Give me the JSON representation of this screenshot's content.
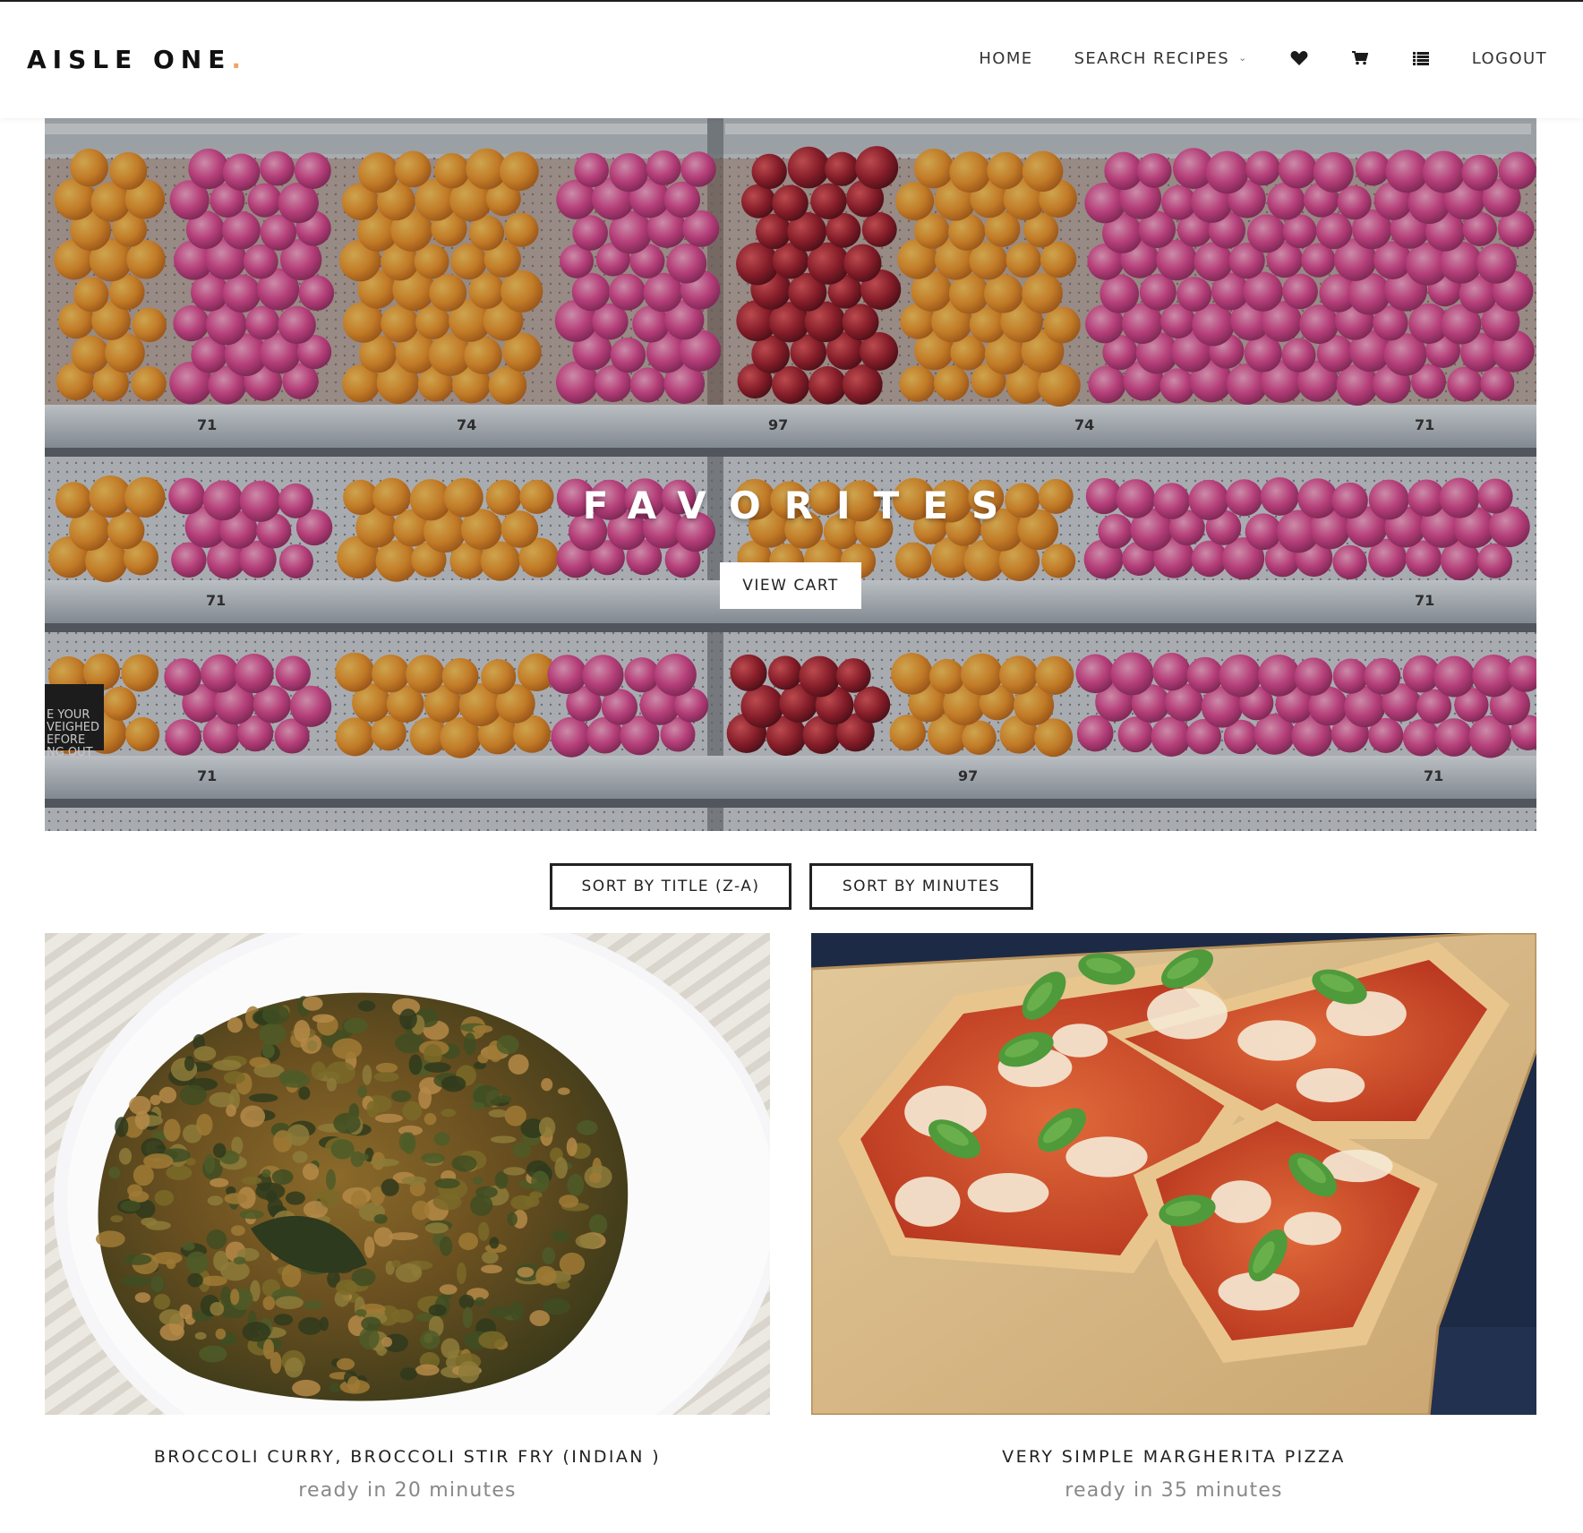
{
  "header": {
    "brand": "AISLE ONE",
    "brand_dot": ".",
    "nav": {
      "home": "HOME",
      "search_recipes": "SEARCH RECIPES",
      "logout": "LOGOUT"
    },
    "icons": [
      "heart-icon",
      "cart-icon",
      "list-icon"
    ]
  },
  "hero": {
    "title": "FAVORITES",
    "button": "VIEW CART",
    "sign_text": [
      "E YOUR",
      "VEIGHED",
      "EFORE",
      "NG OUT"
    ],
    "price_labels": [
      "71",
      "74",
      "97",
      "74",
      "71",
      "71",
      "71",
      "71",
      "97",
      "71"
    ]
  },
  "sort": {
    "by_title": "SORT BY TITLE (Z-A)",
    "by_minutes": "SORT BY MINUTES"
  },
  "recipes": [
    {
      "title": "BROCCOLI CURRY, BROCCOLI STIR FRY (INDIAN )",
      "subtitle": "ready in 20 minutes"
    },
    {
      "title": "VERY SIMPLE MARGHERITA PIZZA",
      "subtitle": "ready in 35 minutes"
    }
  ],
  "colors": {
    "brand_dot": "#f0a36b",
    "text": "#222222",
    "muted": "#888888"
  }
}
